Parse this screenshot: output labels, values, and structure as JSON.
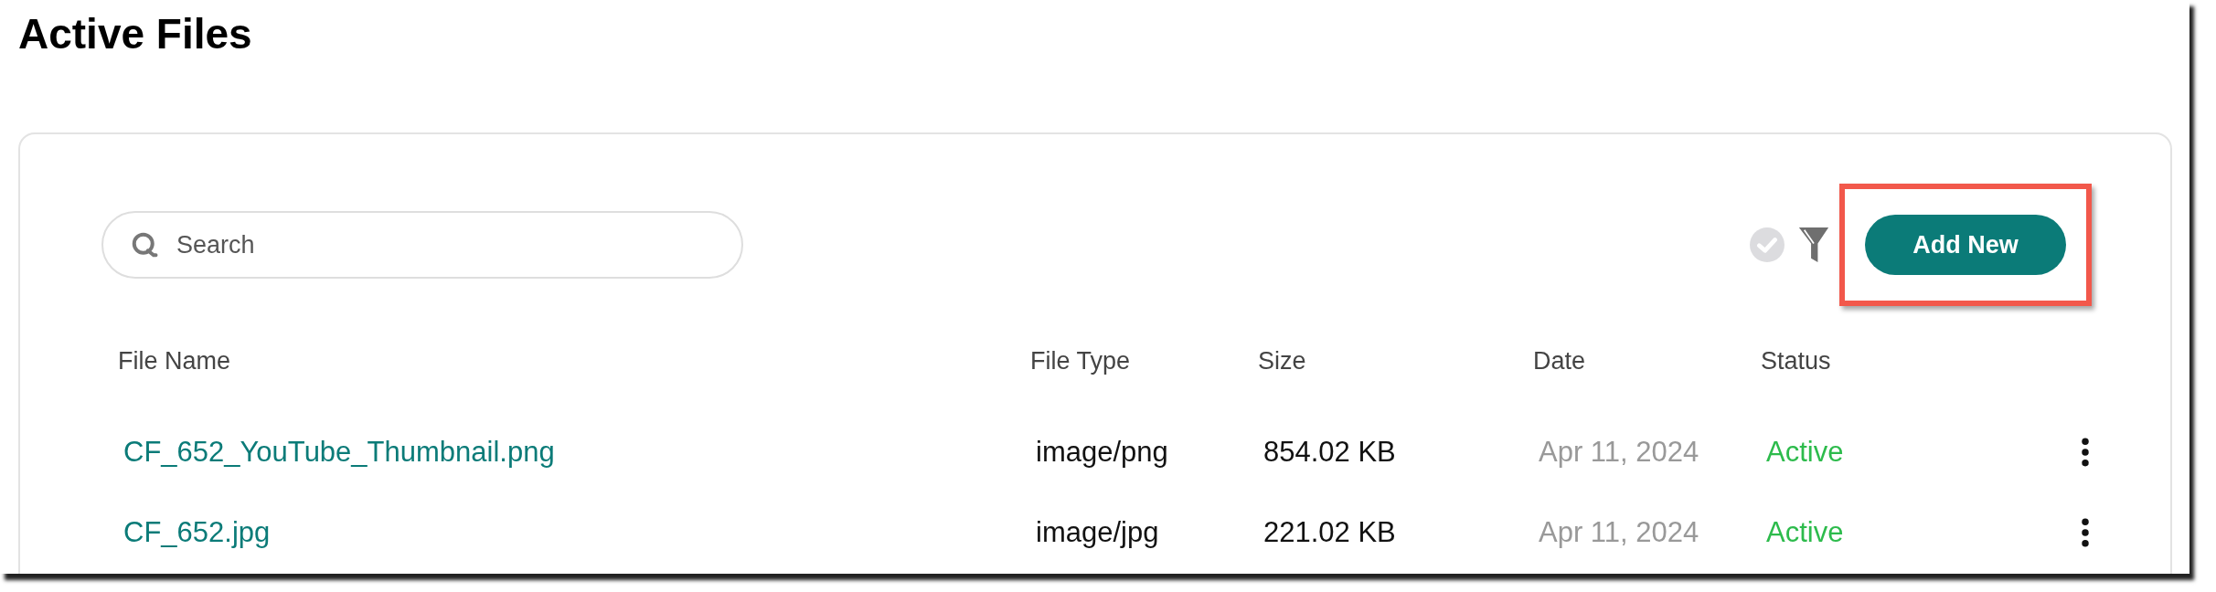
{
  "title": "Active Files",
  "search": {
    "placeholder": "Search"
  },
  "add_button": {
    "label": "Add New",
    "highlighted": true
  },
  "table": {
    "columns": [
      "File Name",
      "File Type",
      "Size",
      "Date",
      "Status"
    ],
    "rows": [
      {
        "name": "CF_652_YouTube_Thumbnail.png",
        "type": "image/png",
        "size": "854.02 KB",
        "date": "Apr 11, 2024",
        "status": "Active"
      },
      {
        "name": "CF_652.jpg",
        "type": "image/jpg",
        "size": "221.02 KB",
        "date": "Apr 11, 2024",
        "status": "Active"
      }
    ]
  }
}
